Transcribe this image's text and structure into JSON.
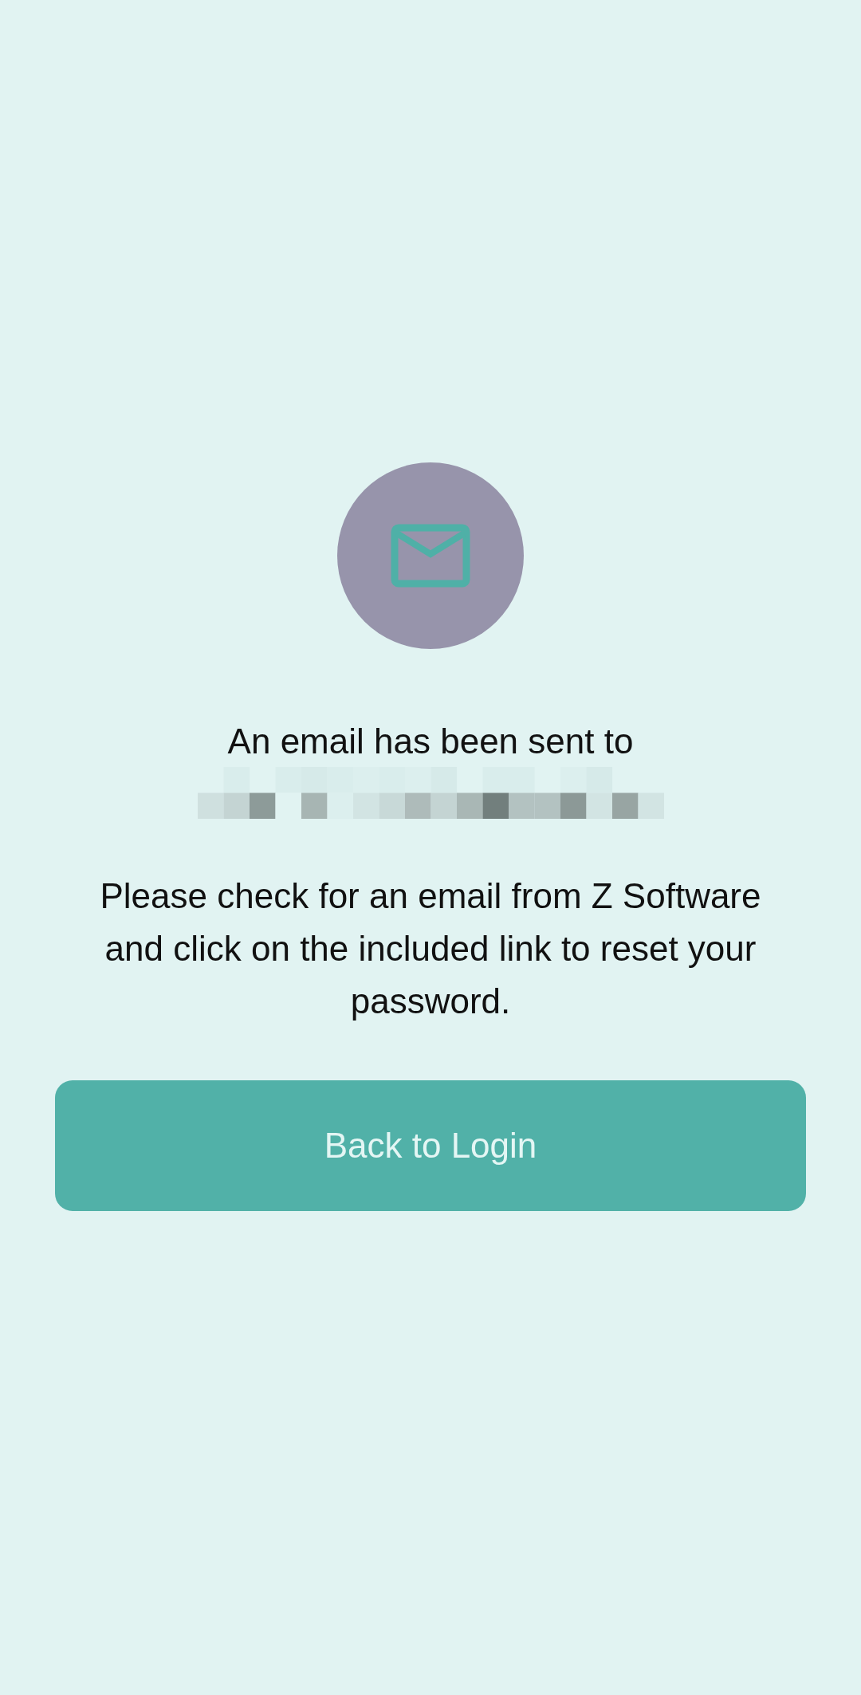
{
  "heading": "An email has been sent to",
  "message": "Please check for an email from Z Software and click on the included link to reset your password.",
  "button": {
    "label": "Back to Login"
  }
}
